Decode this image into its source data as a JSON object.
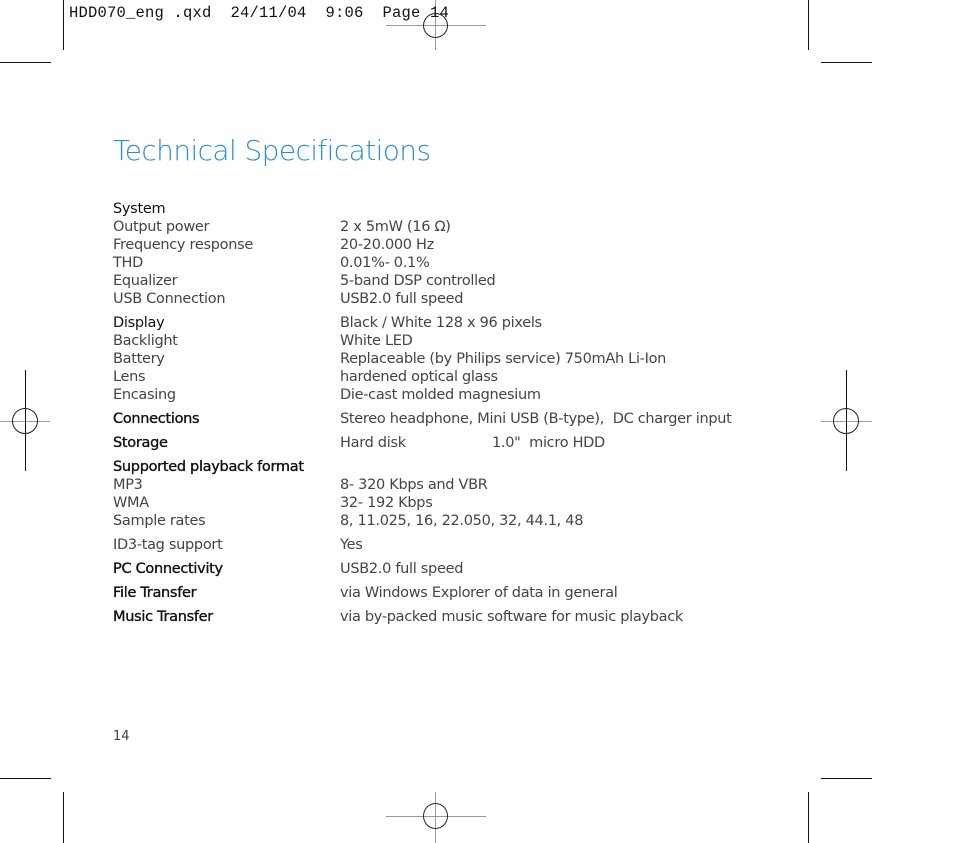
{
  "slug_line": "HDD070_eng .qxd  24/11/04  9:06  Page 14",
  "title": "Technical Specifications",
  "page_number": "14",
  "sections": {
    "system": {
      "heading": "System",
      "rows": [
        {
          "label": "Output power",
          "value": "2 x 5mW (16 Ω)"
        },
        {
          "label": "Frequency response",
          "value": "20-20.000 Hz"
        },
        {
          "label": "THD",
          "value": "0.01%- 0.1%"
        },
        {
          "label": "Equalizer",
          "value": "5-band DSP controlled"
        },
        {
          "label": "USB Connection",
          "value": "USB2.0 full speed"
        }
      ]
    },
    "display": {
      "heading": "Display",
      "value": "Black / White 128 x 96 pixels",
      "rows": [
        {
          "label": "Backlight",
          "value": "White LED"
        },
        {
          "label": "Battery",
          "value": "Replaceable (by Philips service) 750mAh Li-Ion"
        },
        {
          "label": "Lens",
          "value": "hardened optical glass"
        },
        {
          "label": "Encasing",
          "value": "Die-cast molded magnesium"
        }
      ]
    },
    "connections": {
      "heading": "Connections",
      "value": "Stereo headphone, Mini USB (B-type),  DC charger input"
    },
    "storage": {
      "heading": "Storage",
      "value": "Hard disk                    1.0\"  micro HDD"
    },
    "playback": {
      "heading": "Supported playback format",
      "rows": [
        {
          "label": "MP3",
          "value": "8- 320 Kbps and VBR"
        },
        {
          "label": "WMA",
          "value": "32- 192 Kbps"
        },
        {
          "label": "Sample rates",
          "value": "8, 11.025, 16, 22.050, 32, 44.1, 48"
        }
      ]
    },
    "id3": {
      "label": "ID3-tag support",
      "value": "Yes"
    },
    "pc": {
      "heading": "PC Connectivity",
      "value": "USB2.0 full speed"
    },
    "file": {
      "heading": "File Transfer",
      "value": "via Windows Explorer of data in general"
    },
    "music": {
      "heading": "Music Transfer",
      "value": "via by-packed music software for music playback"
    }
  }
}
